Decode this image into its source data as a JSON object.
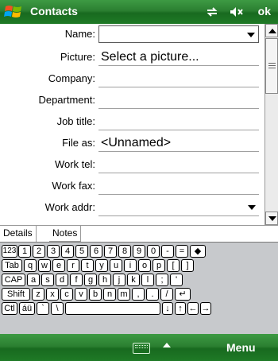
{
  "titlebar": {
    "title": "Contacts",
    "ok_label": "ok",
    "icons": [
      "windows-logo-icon",
      "connectivity-icon",
      "volume-muted-icon"
    ]
  },
  "form": {
    "fields": [
      {
        "label": "Name:",
        "value": "",
        "type": "dropdown"
      },
      {
        "label": "Picture:",
        "value": "Select a picture..."
      },
      {
        "label": "Company:",
        "value": ""
      },
      {
        "label": "Department:",
        "value": ""
      },
      {
        "label": "Job title:",
        "value": ""
      },
      {
        "label": "File as:",
        "value": "<Unnamed>"
      },
      {
        "label": "Work tel:",
        "value": ""
      },
      {
        "label": "Work fax:",
        "value": ""
      },
      {
        "label": "Work addr:",
        "value": "",
        "type": "dropdown"
      }
    ]
  },
  "tabs": [
    "Details",
    "Notes"
  ],
  "keyboard": {
    "rows": [
      [
        "123",
        "1",
        "2",
        "3",
        "4",
        "5",
        "6",
        "7",
        "8",
        "9",
        "0",
        "-",
        "=",
        "◆"
      ],
      [
        "Tab",
        "q",
        "w",
        "e",
        "r",
        "t",
        "y",
        "u",
        "i",
        "o",
        "p",
        "[",
        "]"
      ],
      [
        "CAP",
        "a",
        "s",
        "d",
        "f",
        "g",
        "h",
        "j",
        "k",
        "l",
        ";",
        "'"
      ],
      [
        "Shift",
        "z",
        "x",
        "c",
        "v",
        "b",
        "n",
        "m",
        ",",
        ".",
        "/",
        "↵"
      ],
      [
        "Ctl",
        "áü",
        "`",
        "\\",
        "",
        "↓",
        "↑",
        "←",
        "→"
      ]
    ]
  },
  "bottombar": {
    "menu_label": "Menu",
    "icons": [
      "keyboard-icon",
      "sip-up-arrow-icon"
    ]
  }
}
